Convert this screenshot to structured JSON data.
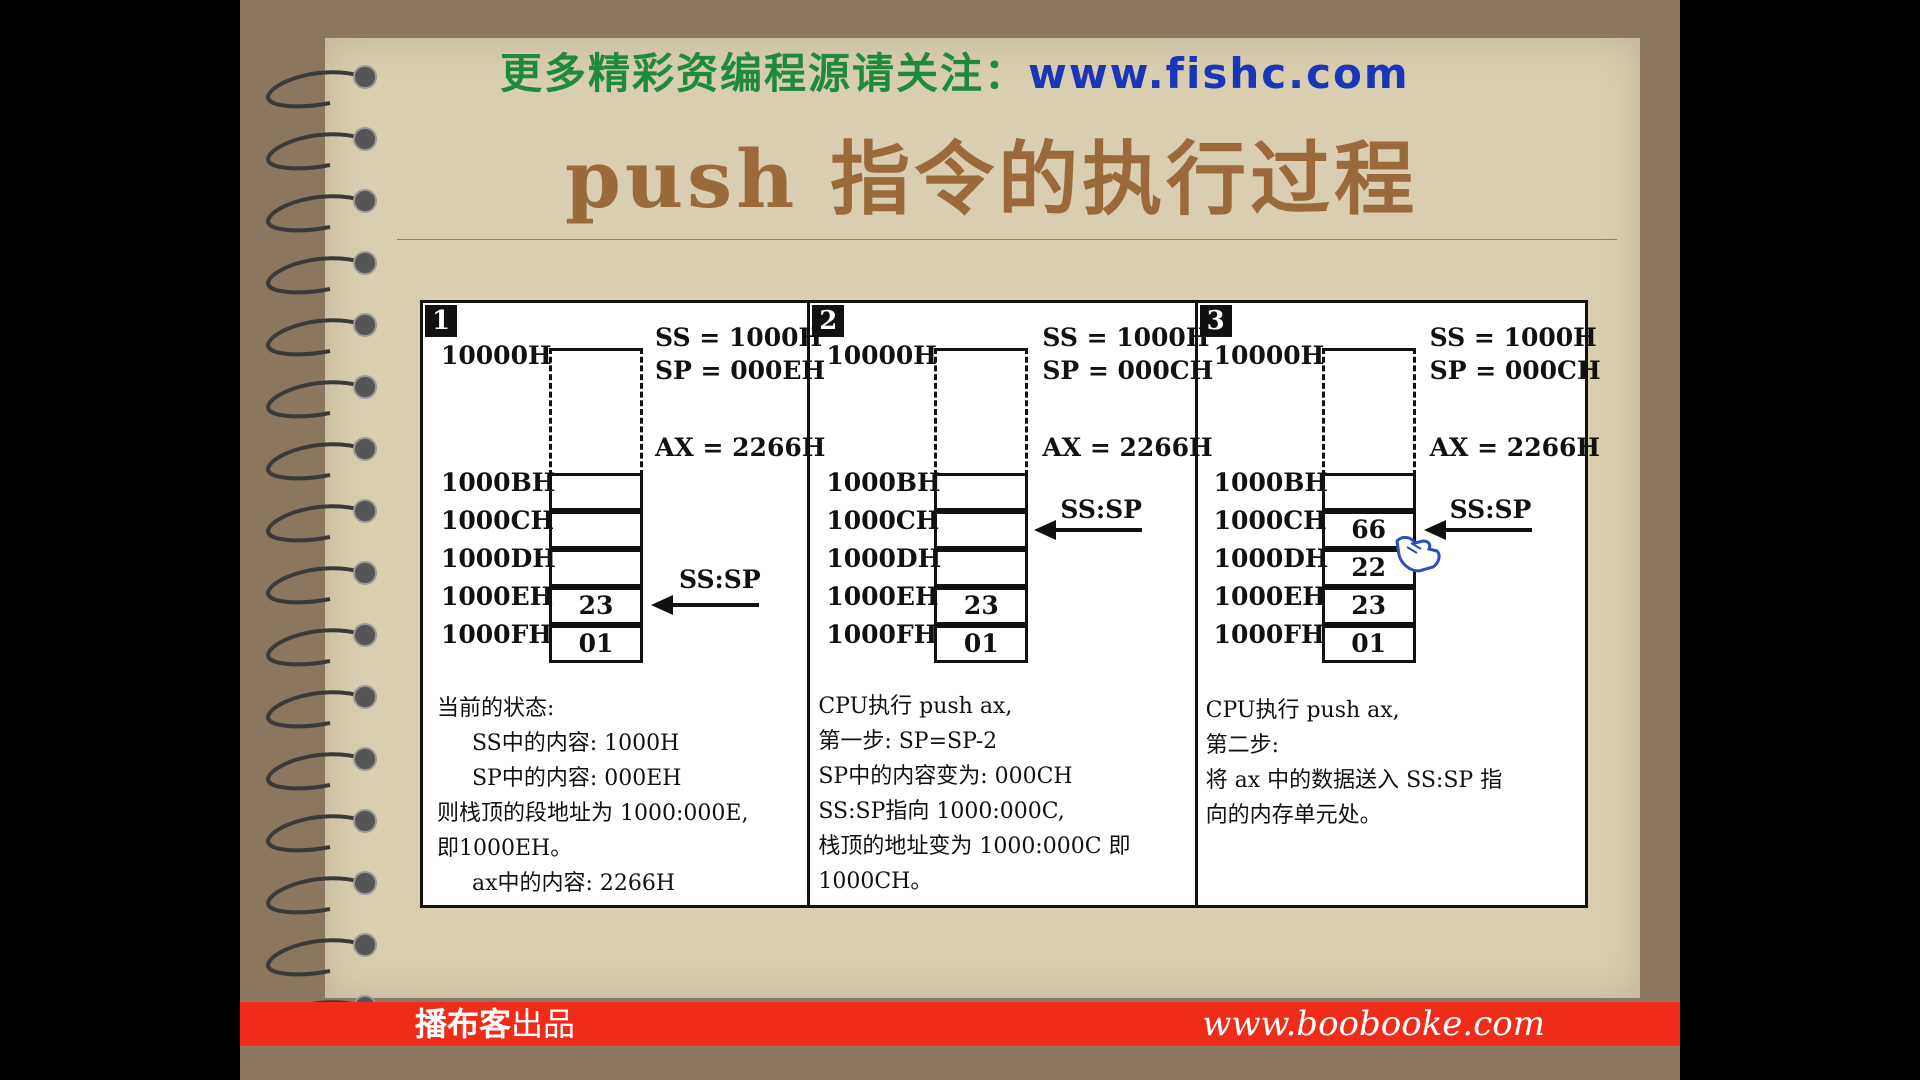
{
  "banner": {
    "prefix": "更多精彩资编程源请关注：",
    "url": "www.fishc.com"
  },
  "title": "push 指令的执行过程",
  "panels": [
    {
      "number": "1",
      "ss": "SS = 1000H",
      "sp": "SP = 000EH",
      "ax": "AX = 2266H",
      "pointer_label": "SS:SP",
      "addresses": [
        "10000H",
        "1000BH",
        "1000CH",
        "1000DH",
        "1000EH",
        "1000FH"
      ],
      "cells": [
        "",
        "",
        "",
        "23",
        "01"
      ],
      "desc": "当前的状态:\n     SS中的内容: 1000H\n     SP中的内容: 000EH\n则栈顶的段地址为 1000:000E,\n即1000EH。\n     ax中的内容: 2266H"
    },
    {
      "number": "2",
      "ss": "SS = 1000H",
      "sp": "SP = 000CH",
      "ax": "AX = 2266H",
      "pointer_label": "SS:SP",
      "addresses": [
        "10000H",
        "1000BH",
        "1000CH",
        "1000DH",
        "1000EH",
        "1000FH"
      ],
      "cells": [
        "",
        "",
        "",
        "23",
        "01"
      ],
      "desc": "CPU执行 push ax,\n第一步: SP=SP-2\nSP中的内容变为: 000CH\nSS:SP指向 1000:000C,\n栈顶的地址变为 1000:000C 即\n1000CH。"
    },
    {
      "number": "3",
      "ss": "SS = 1000H",
      "sp": "SP = 000CH",
      "ax": "AX = 2266H",
      "pointer_label": "SS:SP",
      "addresses": [
        "10000H",
        "1000BH",
        "1000CH",
        "1000DH",
        "1000EH",
        "1000FH"
      ],
      "cells": [
        "",
        "66",
        "22",
        "23",
        "01"
      ],
      "desc": "CPU执行 push ax,\n第二步:\n将 ax 中的数据送入 SS:SP 指\n向的内存单元处。"
    }
  ],
  "footer": {
    "brand_bold": "播布客",
    "brand_rest": "出品",
    "url": "www.boobooke.com"
  },
  "colors": {
    "banner_green": "#1f8a3a",
    "banner_blue": "#1a35b5",
    "title_brown": "#9a6a3a",
    "bar_red": "#ef2b1a"
  }
}
